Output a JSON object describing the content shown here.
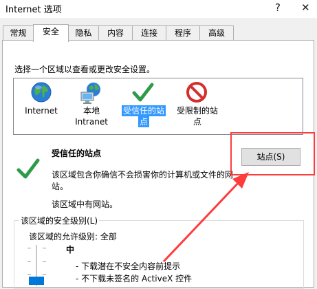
{
  "window": {
    "title": "Internet 选项",
    "help_glyph": "?",
    "close_glyph": "✕"
  },
  "tabs": [
    {
      "label": "常规"
    },
    {
      "label": "安全"
    },
    {
      "label": "隐私"
    },
    {
      "label": "内容"
    },
    {
      "label": "连接"
    },
    {
      "label": "程序"
    },
    {
      "label": "高级"
    }
  ],
  "active_tab": "安全",
  "security": {
    "select_zone_prompt": "选择一个区域以查看或更改安全设置。",
    "zones": [
      {
        "line1": "Internet",
        "line2": "",
        "icon": "globe-icon"
      },
      {
        "line1": "本地",
        "line2": "Intranet",
        "icon": "local-intranet-icon"
      },
      {
        "line1": "受信任的站",
        "line2": "点",
        "icon": "trusted-check-icon",
        "selected": true
      },
      {
        "line1": "受限制的站",
        "line2": "点",
        "icon": "restricted-icon"
      }
    ],
    "zone_title": "受信任的站点",
    "zone_desc_line1": "该区域包含你确信不会损害你的计算机或文件的网",
    "zone_desc_line2": "站。",
    "zone_note": "该区域中有网站。",
    "sites_button": "站点(S)",
    "level_group_title": "该区域的安全级别(L)",
    "allowed_levels": "该区域的允许级别: 全部",
    "level_name": "中",
    "level_items": [
      "- 下载潜在不安全内容前提示",
      "- 不下载未签名的 ActiveX 控件"
    ]
  },
  "colors": {
    "selection": "#3399ff",
    "annotation": "#ff3c3c",
    "slider": "#0078d7"
  }
}
